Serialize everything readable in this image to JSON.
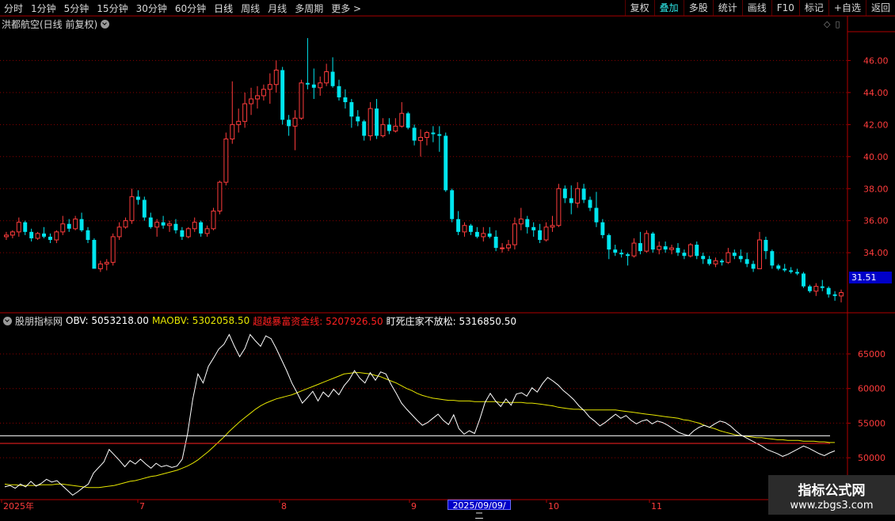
{
  "toolbar": {
    "periods": [
      "分时",
      "1分钟",
      "5分钟",
      "15分钟",
      "30分钟",
      "60分钟",
      "日线",
      "周线",
      "月线",
      "多周期",
      "更多 >"
    ],
    "active_period": "日线",
    "right_buttons": [
      "复权",
      "叠加",
      "多股",
      "统计",
      "画线",
      "F10",
      "标记",
      "+自选",
      "返回"
    ],
    "highlight_button": "叠加"
  },
  "stock_title": "洪都航空(日线 前复权)",
  "price_axis": {
    "ticks": [
      "46.00",
      "44.00",
      "42.00",
      "40.00",
      "38.00",
      "36.00",
      "34.00"
    ],
    "values": [
      46,
      44,
      42,
      40,
      38,
      36,
      34
    ],
    "min": 30.4,
    "max": 47.8
  },
  "current_price": "31.51",
  "indicator": {
    "name": "股朋指标网",
    "obv": "OBV: 5053218.00",
    "maobv": "MAOBV: 5302058.50",
    "line3": "超越暴富资金线: 5207926.50",
    "line4": "盯死庄家不放松: 5316850.50"
  },
  "obv_axis": {
    "ticks": [
      "65000",
      "60000",
      "55000",
      "50000"
    ],
    "values": [
      65000,
      60000,
      55000,
      50000
    ],
    "min": 44300,
    "max": 69000
  },
  "x_labels": [
    "2025年",
    "7",
    "8",
    "9",
    "10",
    "11"
  ],
  "cursor_date": "2025/09/09/二",
  "watermark": {
    "title": "指标公式网",
    "url": "www.zbgs3.com"
  },
  "colors": {
    "up": "#ff3c3c",
    "down": "#00e5ee",
    "obv": "#ffffff",
    "maobv": "#e6e600",
    "line3": "#ff2020",
    "line4": "#ffffff",
    "grid": "#8b0000"
  },
  "chart_data": [
    {
      "type": "candlestick",
      "title": "洪都航空(日线 前复权)",
      "ohlc": [
        [
          35.0,
          35.3,
          34.8,
          35.1
        ],
        [
          35.1,
          35.4,
          34.9,
          35.3
        ],
        [
          35.3,
          36.2,
          35.0,
          35.9
        ],
        [
          35.9,
          36.0,
          35.1,
          35.3
        ],
        [
          35.3,
          35.5,
          34.7,
          34.9
        ],
        [
          34.9,
          35.3,
          34.8,
          35.2
        ],
        [
          35.2,
          35.6,
          34.9,
          35.0
        ],
        [
          35.0,
          35.2,
          34.6,
          34.8
        ],
        [
          34.8,
          35.4,
          34.6,
          35.3
        ],
        [
          35.3,
          36.3,
          35.1,
          35.8
        ],
        [
          35.8,
          36.1,
          35.3,
          35.5
        ],
        [
          35.5,
          36.3,
          35.4,
          36.1
        ],
        [
          36.1,
          36.5,
          35.3,
          35.4
        ],
        [
          35.4,
          35.6,
          34.6,
          34.8
        ],
        [
          34.8,
          34.9,
          33.2,
          33.0
        ],
        [
          33.0,
          33.5,
          32.8,
          33.3
        ],
        [
          33.3,
          33.6,
          32.9,
          33.4
        ],
        [
          33.4,
          35.2,
          33.2,
          35.0
        ],
        [
          35.0,
          35.9,
          34.8,
          35.6
        ],
        [
          35.6,
          36.2,
          35.5,
          36.0
        ],
        [
          36.0,
          38.0,
          35.8,
          37.5
        ],
        [
          37.5,
          37.9,
          37.0,
          37.3
        ],
        [
          37.3,
          37.5,
          36.0,
          36.2
        ],
        [
          36.2,
          36.5,
          35.5,
          35.6
        ],
        [
          35.6,
          36.1,
          35.0,
          35.9
        ],
        [
          35.9,
          36.3,
          35.5,
          35.7
        ],
        [
          35.7,
          36.0,
          35.3,
          35.8
        ],
        [
          35.8,
          36.1,
          35.2,
          35.4
        ],
        [
          35.4,
          35.6,
          34.8,
          35.0
        ],
        [
          35.0,
          35.6,
          34.9,
          35.5
        ],
        [
          35.5,
          36.2,
          35.3,
          35.9
        ],
        [
          35.9,
          36.0,
          35.0,
          35.2
        ],
        [
          35.2,
          35.7,
          35.0,
          35.5
        ],
        [
          35.5,
          36.8,
          35.4,
          36.6
        ],
        [
          36.6,
          38.5,
          36.4,
          38.4
        ],
        [
          38.4,
          41.5,
          38.2,
          41.1
        ],
        [
          41.1,
          44.7,
          40.8,
          42.0
        ],
        [
          42.0,
          43.0,
          41.5,
          42.2
        ],
        [
          42.2,
          44.0,
          41.8,
          43.3
        ],
        [
          43.3,
          44.3,
          42.6,
          43.6
        ],
        [
          43.6,
          44.4,
          43.0,
          43.8
        ],
        [
          43.8,
          44.5,
          43.5,
          44.2
        ],
        [
          44.2,
          45.2,
          43.3,
          44.5
        ],
        [
          44.5,
          46.0,
          44.0,
          45.4
        ],
        [
          45.4,
          45.6,
          42.0,
          42.3
        ],
        [
          42.3,
          42.6,
          41.3,
          41.9
        ],
        [
          41.9,
          42.9,
          40.4,
          42.4
        ],
        [
          42.4,
          44.8,
          42.3,
          44.6
        ],
        [
          44.6,
          47.4,
          44.2,
          44.5
        ],
        [
          44.5,
          45.5,
          43.6,
          44.3
        ],
        [
          44.3,
          45.0,
          43.8,
          44.6
        ],
        [
          44.6,
          45.8,
          44.4,
          45.3
        ],
        [
          45.3,
          46.2,
          44.3,
          44.4
        ],
        [
          44.4,
          44.8,
          43.5,
          43.7
        ],
        [
          43.7,
          44.2,
          43.0,
          43.4
        ],
        [
          43.4,
          43.6,
          41.8,
          42.5
        ],
        [
          42.5,
          42.9,
          41.9,
          42.2
        ],
        [
          42.2,
          42.3,
          41.0,
          41.3
        ],
        [
          41.3,
          43.4,
          41.0,
          43.0
        ],
        [
          43.0,
          43.6,
          41.1,
          41.3
        ],
        [
          41.3,
          42.4,
          41.2,
          42.0
        ],
        [
          42.0,
          42.4,
          41.4,
          41.6
        ],
        [
          41.6,
          42.4,
          41.5,
          41.9
        ],
        [
          41.9,
          43.4,
          41.8,
          42.7
        ],
        [
          42.7,
          42.8,
          41.7,
          41.8
        ],
        [
          41.8,
          42.0,
          40.7,
          41.0
        ],
        [
          41.0,
          41.7,
          40.0,
          41.2
        ],
        [
          41.2,
          41.6,
          40.7,
          41.5
        ],
        [
          41.5,
          41.9,
          40.9,
          41.4
        ],
        [
          41.4,
          41.9,
          40.3,
          41.3
        ],
        [
          41.3,
          41.5,
          37.8,
          37.9
        ],
        [
          37.9,
          38.0,
          35.9,
          36.1
        ],
        [
          36.1,
          36.6,
          35.1,
          35.3
        ],
        [
          35.3,
          35.9,
          35.0,
          35.7
        ],
        [
          35.7,
          35.8,
          35.1,
          35.3
        ],
        [
          35.3,
          35.6,
          34.9,
          35.0
        ],
        [
          35.0,
          35.6,
          34.7,
          35.2
        ],
        [
          35.2,
          35.6,
          34.9,
          35.0
        ],
        [
          35.0,
          35.4,
          34.1,
          34.3
        ],
        [
          34.3,
          34.6,
          34.0,
          34.3
        ],
        [
          34.3,
          34.8,
          34.1,
          34.5
        ],
        [
          34.5,
          36.2,
          34.2,
          35.8
        ],
        [
          35.8,
          36.8,
          35.4,
          36.1
        ],
        [
          36.1,
          36.3,
          35.2,
          35.6
        ],
        [
          35.6,
          35.9,
          35.0,
          35.4
        ],
        [
          35.4,
          35.8,
          34.6,
          34.8
        ],
        [
          34.8,
          35.9,
          34.7,
          35.6
        ],
        [
          35.6,
          36.3,
          35.3,
          35.7
        ],
        [
          35.7,
          38.3,
          35.6,
          38.0
        ],
        [
          38.0,
          38.2,
          37.1,
          37.4
        ],
        [
          37.4,
          38.2,
          36.4,
          37.1
        ],
        [
          37.1,
          38.4,
          36.8,
          38.0
        ],
        [
          38.0,
          38.3,
          37.1,
          37.3
        ],
        [
          37.3,
          37.5,
          36.6,
          36.8
        ],
        [
          36.8,
          37.8,
          35.6,
          35.9
        ],
        [
          35.9,
          36.1,
          34.9,
          35.1
        ],
        [
          35.1,
          35.2,
          33.6,
          34.2
        ],
        [
          34.2,
          34.5,
          33.8,
          34.0
        ],
        [
          34.0,
          34.2,
          33.7,
          33.9
        ],
        [
          33.9,
          34.0,
          33.2,
          33.8
        ],
        [
          33.8,
          34.9,
          33.7,
          34.6
        ],
        [
          34.6,
          35.3,
          33.9,
          34.1
        ],
        [
          34.1,
          35.4,
          34.0,
          35.2
        ],
        [
          35.2,
          35.3,
          34.0,
          34.2
        ],
        [
          34.2,
          34.7,
          33.9,
          34.4
        ],
        [
          34.4,
          34.7,
          34.0,
          34.2
        ],
        [
          34.2,
          34.5,
          33.9,
          34.3
        ],
        [
          34.3,
          34.6,
          33.8,
          34.0
        ],
        [
          34.0,
          34.2,
          33.6,
          33.8
        ],
        [
          33.8,
          34.6,
          33.7,
          34.5
        ],
        [
          34.5,
          34.7,
          33.6,
          33.8
        ],
        [
          33.8,
          34.0,
          33.3,
          33.6
        ],
        [
          33.6,
          33.8,
          33.2,
          33.3
        ],
        [
          33.3,
          33.7,
          33.1,
          33.5
        ],
        [
          33.5,
          33.6,
          33.2,
          33.4
        ],
        [
          33.4,
          34.3,
          33.3,
          34.0
        ],
        [
          34.0,
          34.2,
          33.6,
          33.8
        ],
        [
          33.8,
          34.2,
          33.4,
          33.6
        ],
        [
          33.6,
          34.0,
          33.1,
          33.3
        ],
        [
          33.3,
          33.5,
          32.8,
          33.0
        ],
        [
          33.0,
          35.3,
          33.0,
          34.8
        ],
        [
          34.8,
          35.0,
          33.6,
          34.1
        ],
        [
          34.1,
          34.2,
          33.0,
          33.2
        ],
        [
          33.2,
          33.3,
          32.9,
          33.0
        ],
        [
          33.0,
          33.3,
          32.8,
          32.9
        ],
        [
          32.9,
          33.1,
          32.7,
          32.8
        ],
        [
          32.8,
          33.0,
          32.6,
          32.7
        ],
        [
          32.7,
          32.8,
          31.8,
          31.9
        ],
        [
          31.9,
          32.0,
          31.5,
          31.6
        ],
        [
          31.6,
          32.1,
          31.3,
          31.9
        ],
        [
          31.9,
          32.3,
          31.6,
          31.8
        ],
        [
          31.8,
          31.9,
          31.2,
          31.4
        ],
        [
          31.4,
          31.6,
          31.0,
          31.3
        ],
        [
          31.3,
          31.7,
          30.9,
          31.51
        ]
      ]
    },
    {
      "type": "line",
      "title": "股朋指标网",
      "series": [
        {
          "name": "OBV",
          "values": [
            45800,
            46000,
            45600,
            46200,
            45800,
            46600,
            45900,
            46300,
            46900,
            46500,
            46700,
            46000,
            45300,
            44600,
            45100,
            45700,
            46200,
            47800,
            48600,
            49400,
            51200,
            50400,
            49600,
            48700,
            49600,
            49100,
            49800,
            49100,
            48500,
            49200,
            48700,
            48900,
            48600,
            48800,
            49800,
            53400,
            58400,
            62100,
            60800,
            63200,
            64400,
            65700,
            66400,
            67800,
            66100,
            64600,
            65800,
            67800,
            66900,
            66100,
            67600,
            67200,
            65800,
            64200,
            62600,
            60800,
            59400,
            57900,
            58700,
            59600,
            58200,
            59500,
            58800,
            59900,
            59100,
            60400,
            61300,
            62600,
            61500,
            60800,
            62300,
            61200,
            62400,
            62100,
            60600,
            59300,
            57900,
            57000,
            56200,
            55400,
            54700,
            55100,
            55700,
            56300,
            55400,
            54800,
            56200,
            54200,
            53400,
            53900,
            53500,
            55600,
            58000,
            59300,
            58200,
            57400,
            58500,
            57600,
            59200,
            59400,
            58900,
            60100,
            59500,
            60700,
            61600,
            61100,
            60500,
            59700,
            59100,
            58400,
            57500,
            56800,
            55900,
            55300,
            54600,
            55100,
            55700,
            56300,
            55700,
            56100,
            55400,
            54900,
            55300,
            55500,
            54900,
            55300,
            55100,
            54700,
            54200,
            53700,
            53400,
            53200,
            53900,
            54400,
            54700,
            54400,
            54900,
            55300,
            55100,
            54600,
            53900,
            53300,
            52900,
            52500,
            52100,
            51700,
            51200,
            50900,
            50600,
            50200,
            50500,
            50900,
            51300,
            51700,
            51400,
            51000,
            50600,
            50300,
            50700,
            51000
          ]
        },
        {
          "name": "MAOBV",
          "values": [
            46200,
            46100,
            46100,
            46000,
            46000,
            46000,
            46000,
            46100,
            46100,
            46100,
            46200,
            46200,
            46100,
            46000,
            45900,
            45800,
            45700,
            45700,
            45700,
            45800,
            45900,
            46000,
            46200,
            46400,
            46600,
            46700,
            46900,
            47100,
            47300,
            47400,
            47600,
            47800,
            48000,
            48200,
            48500,
            48800,
            49200,
            49700,
            50300,
            50900,
            51600,
            52300,
            53000,
            53800,
            54500,
            55200,
            55800,
            56400,
            57000,
            57500,
            57900,
            58200,
            58500,
            58700,
            58900,
            59100,
            59400,
            59700,
            60000,
            60300,
            60600,
            60900,
            61200,
            61500,
            61800,
            62100,
            62200,
            62300,
            62300,
            62200,
            62100,
            61900,
            61700,
            61400,
            61100,
            60800,
            60400,
            60000,
            59700,
            59300,
            59000,
            58800,
            58600,
            58500,
            58400,
            58300,
            58300,
            58200,
            58200,
            58200,
            58100,
            58100,
            58100,
            58100,
            58100,
            58000,
            58000,
            58000,
            58000,
            58000,
            57900,
            57900,
            57800,
            57700,
            57600,
            57500,
            57300,
            57200,
            57100,
            57000,
            57000,
            56900,
            56900,
            56900,
            56900,
            56900,
            56900,
            56900,
            56800,
            56700,
            56600,
            56500,
            56400,
            56300,
            56200,
            56100,
            56000,
            55900,
            55800,
            55700,
            55500,
            55400,
            55200,
            55000,
            54700,
            54400,
            54200,
            53900,
            53700,
            53500,
            53300,
            53200,
            53100,
            53000,
            52900,
            52900,
            52800,
            52700,
            52600,
            52600,
            52500,
            52500,
            52500,
            52400,
            52400,
            52400,
            52300,
            52300,
            52200,
            52200
          ]
        },
        {
          "name": "超越暴富资金线",
          "values": [
            52080
          ]
        },
        {
          "name": "盯死庄家不放松",
          "values": [
            53170
          ]
        }
      ]
    }
  ]
}
